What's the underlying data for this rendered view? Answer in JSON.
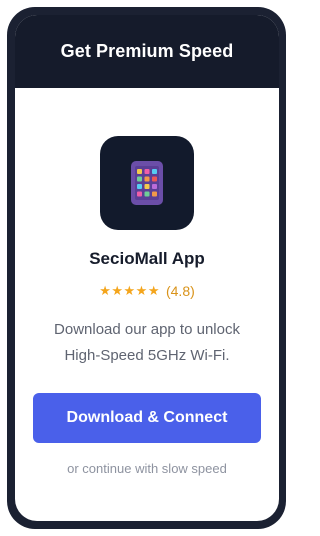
{
  "header": {
    "title": "Get Premium Speed"
  },
  "app": {
    "icon": "app-grid-phone-icon",
    "name": "SecioMall App",
    "stars": "★★★★★",
    "rating": "(4.8)"
  },
  "description": {
    "line1": "Download our app to unlock",
    "line2": "High-Speed 5GHz Wi-Fi."
  },
  "actions": {
    "primary_label": "Download & Connect",
    "secondary_label": "or continue with slow speed"
  },
  "colors": {
    "header_bg": "#151b2b",
    "accent": "#4a60ea",
    "star": "#f4a51c"
  }
}
